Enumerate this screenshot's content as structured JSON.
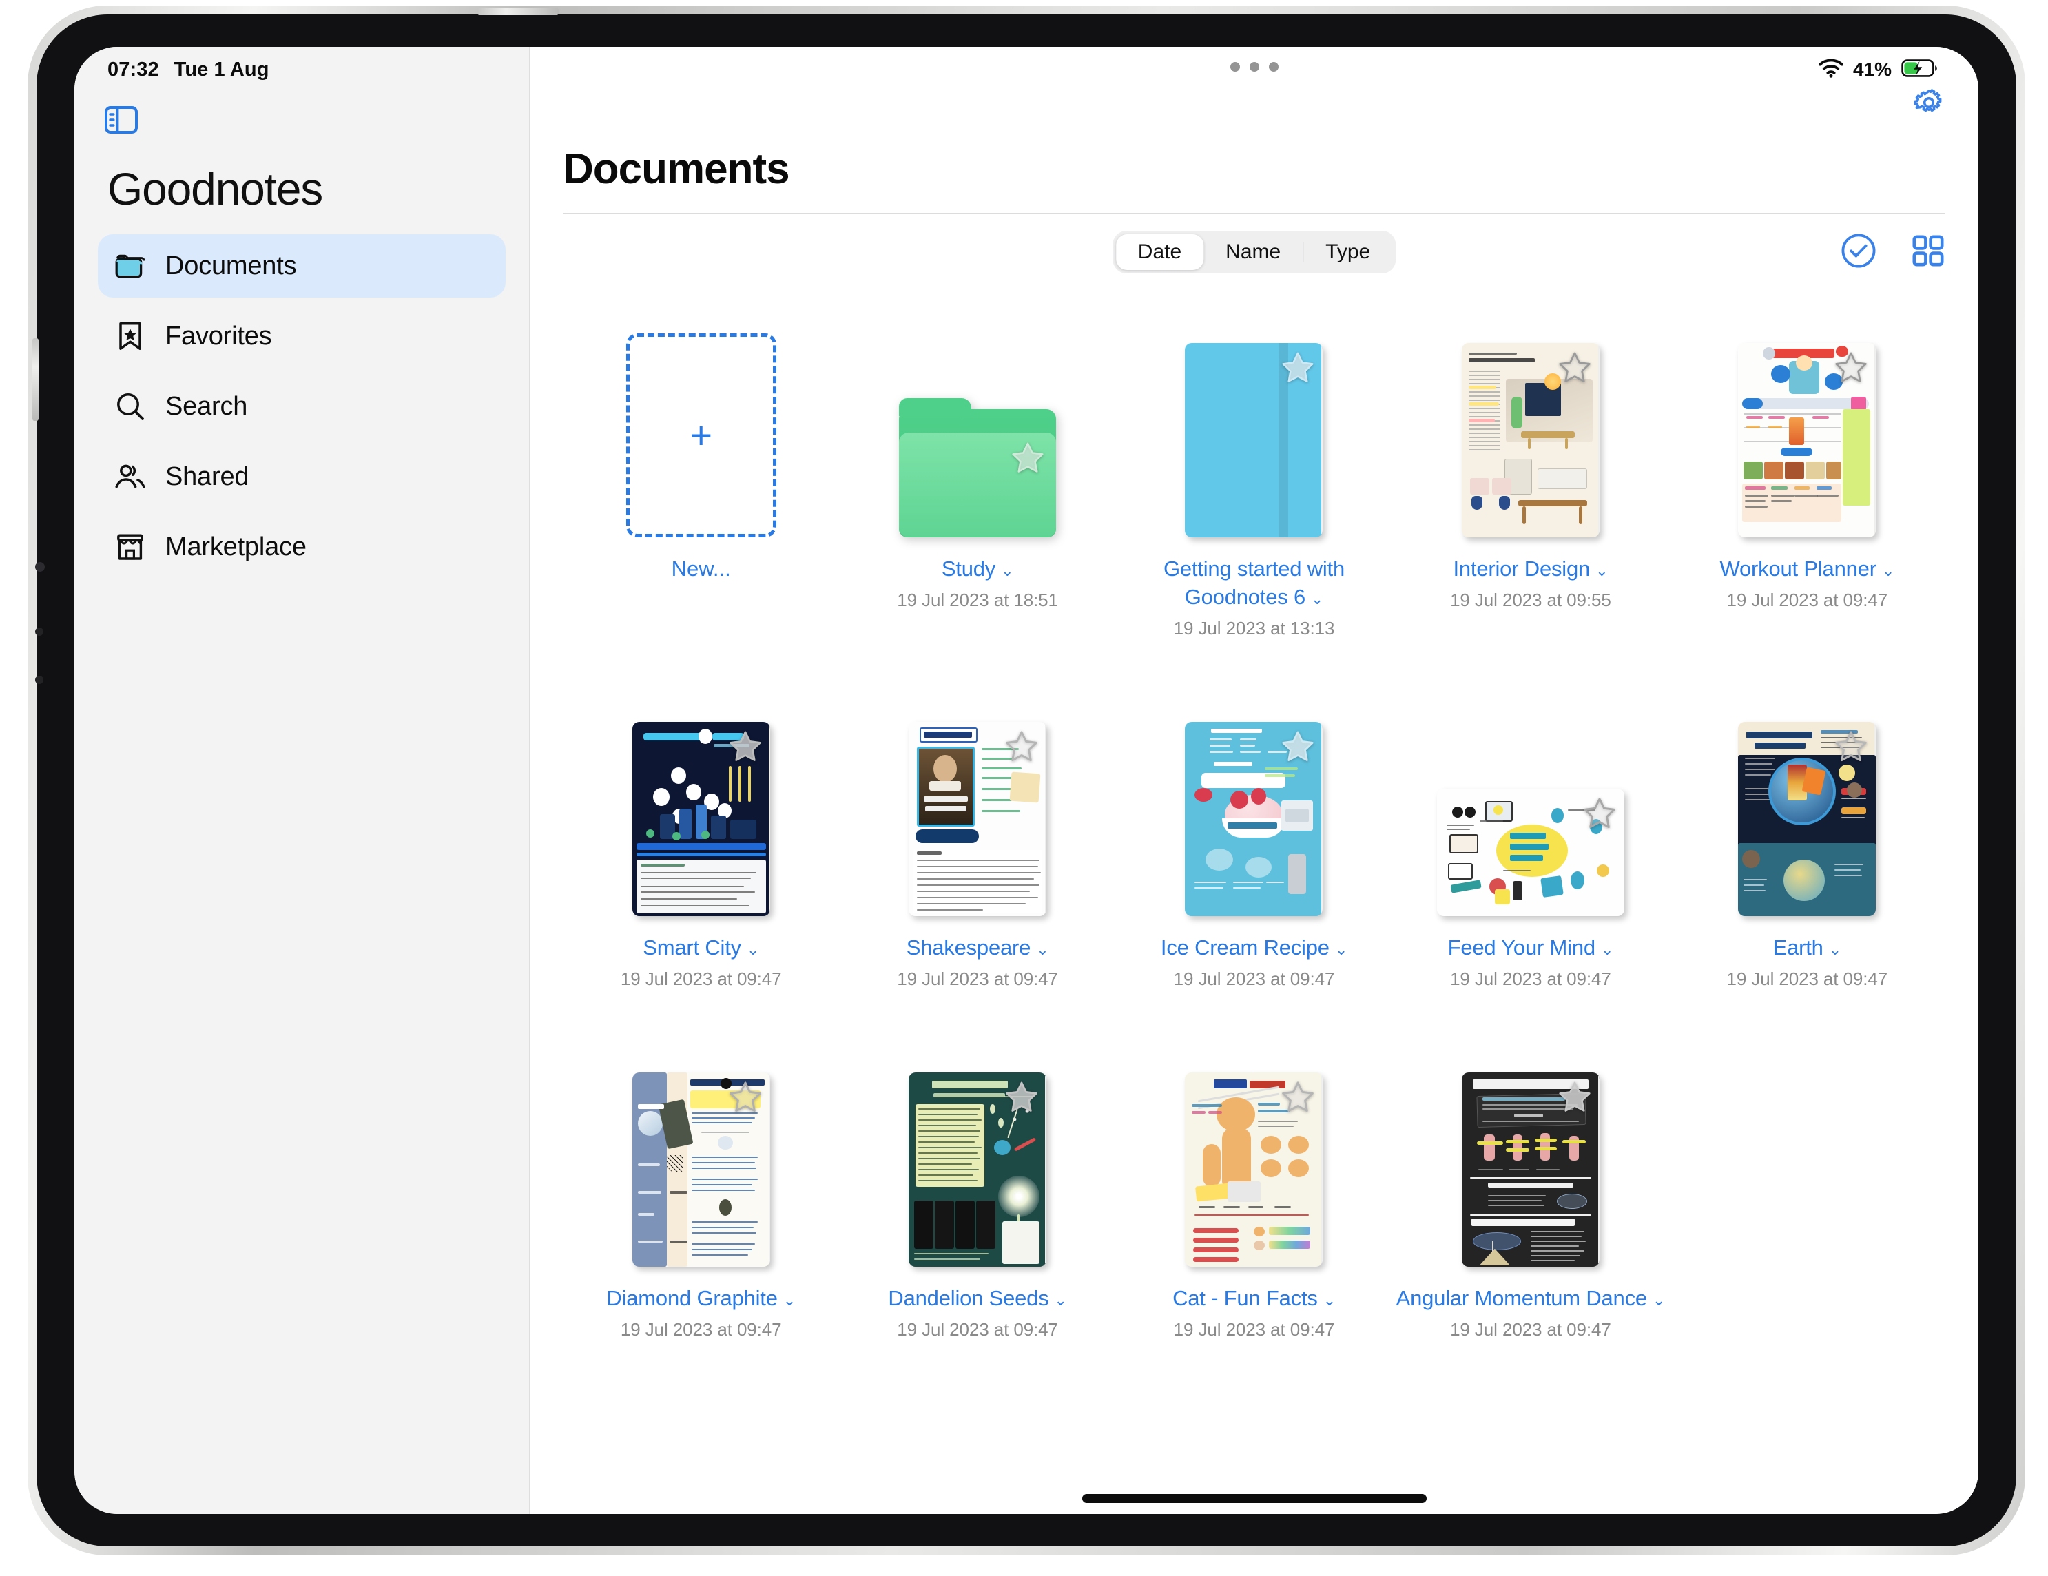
{
  "status_bar": {
    "time": "07:32",
    "date": "Tue 1 Aug",
    "wifi_icon": "wifi-icon",
    "battery_percent": "41%",
    "battery_state": "charging",
    "multitask_icon": "multitasking-dots-icon"
  },
  "sidebar": {
    "toggle_icon": "sidebar-toggle-icon",
    "app_title": "Goodnotes",
    "items": [
      {
        "label": "Documents",
        "icon": "folder-icon",
        "active": true
      },
      {
        "label": "Favorites",
        "icon": "bookmark-star-icon",
        "active": false
      },
      {
        "label": "Search",
        "icon": "search-icon",
        "active": false
      },
      {
        "label": "Shared",
        "icon": "people-icon",
        "active": false
      },
      {
        "label": "Marketplace",
        "icon": "storefront-icon",
        "active": false
      }
    ]
  },
  "header": {
    "title": "Documents",
    "settings_icon": "gear-icon"
  },
  "toolbar": {
    "sort_options": [
      "Date",
      "Name",
      "Type"
    ],
    "sort_selected": "Date",
    "select_icon": "checkmark-circle-icon",
    "view_icon": "grid-view-icon"
  },
  "new_item": {
    "label": "New...",
    "plus_icon": "plus-icon"
  },
  "colors": {
    "accent": "#2a7ae4",
    "sidebar_bg": "#f3f3f3",
    "sidebar_active": "#daeafc",
    "folder_green": "#5ed493",
    "notebook_blue": "#62c8ea",
    "date_text": "#8a8a8a",
    "battery_green": "#37c84a"
  },
  "documents": [
    {
      "name": "Study",
      "date": "19 Jul 2023 at 18:51",
      "type": "folder",
      "favorite": true,
      "cover": "folder-green"
    },
    {
      "name": "Getting started with Goodnotes 6",
      "date": "19 Jul 2023 at 13:13",
      "type": "notebook",
      "favorite": true,
      "cover": "plain-blue"
    },
    {
      "name": "Interior Design",
      "date": "19 Jul 2023 at 09:55",
      "type": "notebook",
      "favorite": true,
      "cover": "interior-design"
    },
    {
      "name": "Workout Planner",
      "date": "19 Jul 2023 at 09:47",
      "type": "notebook",
      "favorite": true,
      "cover": "workout-planner"
    },
    {
      "name": "Smart City",
      "date": "19 Jul 2023 at 09:47",
      "type": "notebook",
      "favorite": true,
      "cover": "smart-city"
    },
    {
      "name": "Shakespeare",
      "date": "19 Jul 2023 at 09:47",
      "type": "notebook",
      "favorite": true,
      "cover": "shakespeare"
    },
    {
      "name": "Ice Cream Recipe",
      "date": "19 Jul 2023 at 09:47",
      "type": "notebook",
      "favorite": true,
      "cover": "ice-cream"
    },
    {
      "name": "Feed Your Mind",
      "date": "19 Jul 2023 at 09:47",
      "type": "notebook",
      "favorite": true,
      "cover": "feed-your-mind"
    },
    {
      "name": "Earth",
      "date": "19 Jul 2023 at 09:47",
      "type": "notebook",
      "favorite": true,
      "cover": "earth"
    },
    {
      "name": "Diamond Graphite",
      "date": "19 Jul 2023 at 09:47",
      "type": "notebook",
      "favorite": true,
      "cover": "diamond-graphite"
    },
    {
      "name": "Dandelion Seeds",
      "date": "19 Jul 2023 at 09:47",
      "type": "notebook",
      "favorite": true,
      "cover": "dandelion"
    },
    {
      "name": "Cat - Fun Facts",
      "date": "19 Jul 2023 at 09:47",
      "type": "notebook",
      "favorite": true,
      "cover": "cat-facts"
    },
    {
      "name": "Angular Momentum Dance",
      "date": "19 Jul 2023 at 09:47",
      "type": "notebook",
      "favorite": true,
      "cover": "angular-momentum"
    }
  ]
}
